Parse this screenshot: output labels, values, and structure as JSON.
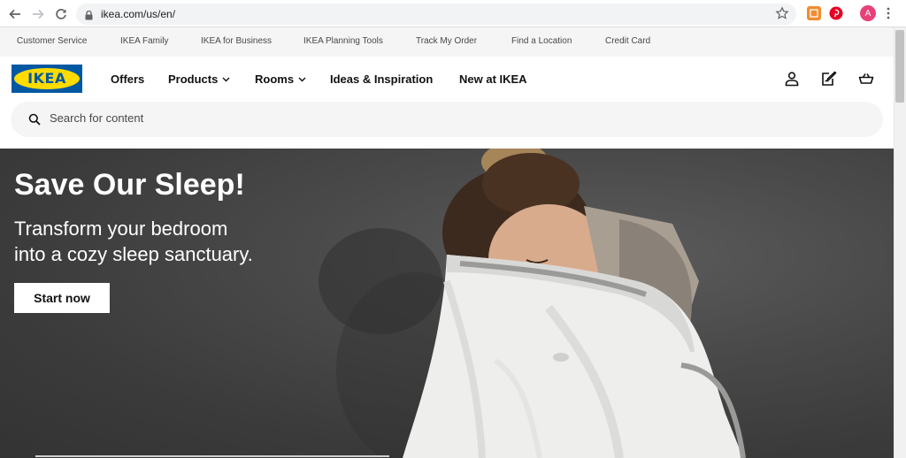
{
  "browser": {
    "url": "ikea.com/us/en/",
    "profile_initial": "A"
  },
  "toplinks": [
    "Customer Service",
    "IKEA Family",
    "IKEA for Business",
    "IKEA Planning Tools",
    "Track My Order",
    "Find a Location",
    "Credit Card"
  ],
  "header": {
    "logo_text": "IKEA",
    "nav": {
      "offers": "Offers",
      "products": "Products",
      "rooms": "Rooms",
      "ideas": "Ideas & Inspiration",
      "new": "New at IKEA"
    }
  },
  "search": {
    "placeholder": "Search for content"
  },
  "hero": {
    "title": "Save Our Sleep!",
    "subtitle_line1": "Transform your bedroom",
    "subtitle_line2": "into a cozy sleep sanctuary.",
    "cta": "Start now"
  },
  "colors": {
    "brand_blue": "#0058a3",
    "brand_yellow": "#ffdb00",
    "hero_bg": "#3f3f3f"
  },
  "icons": [
    "back-arrow-icon",
    "forward-arrow-icon",
    "reload-icon",
    "lock-icon",
    "star-icon",
    "profile-icon",
    "shopping-list-icon",
    "cart-icon",
    "search-icon",
    "chevron-down-icon"
  ]
}
